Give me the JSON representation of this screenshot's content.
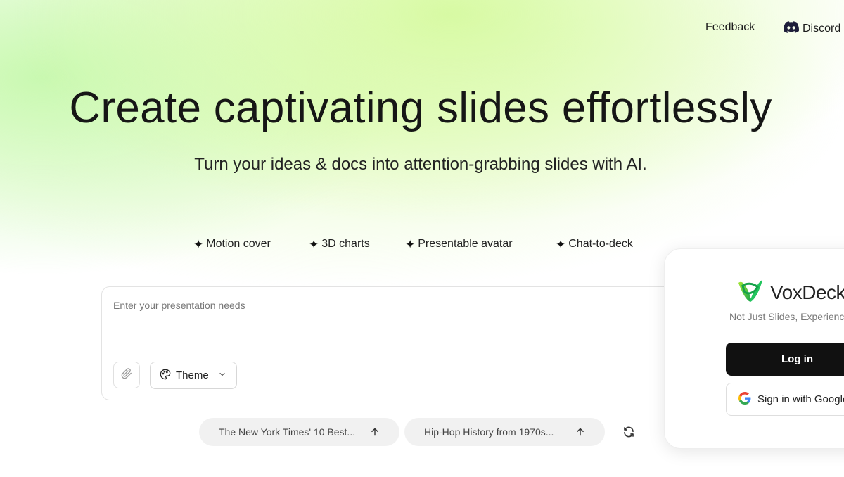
{
  "nav": {
    "feedback": "Feedback",
    "discord": "Discord"
  },
  "hero": {
    "title": "Create captivating slides effortlessly",
    "subtitle": "Turn your ideas & docs into attention-grabbing slides with AI."
  },
  "features": [
    {
      "label": "Motion cover",
      "icon": "sparkle-icon"
    },
    {
      "label": "3D charts",
      "icon": "sparkle-icon"
    },
    {
      "label": "Presentable avatar",
      "icon": "sparkle-icon"
    },
    {
      "label": "Chat-to-deck",
      "icon": "sparkle-icon"
    }
  ],
  "prompt": {
    "placeholder": "Enter your presentation needs",
    "value": "",
    "theme_label": "Theme"
  },
  "suggestions": [
    {
      "label": "The New York Times' 10 Best..."
    },
    {
      "label": "Hip-Hop History from 1970s..."
    }
  ],
  "login": {
    "brand": "VoxDeck",
    "tagline": "Not Just Slides, Experience",
    "login_label": "Log in",
    "google_label": "Sign in with Google"
  },
  "colors": {
    "accent_green": "#22c55e",
    "button_dark": "#111111",
    "hero_glow": "#d6faa0"
  }
}
